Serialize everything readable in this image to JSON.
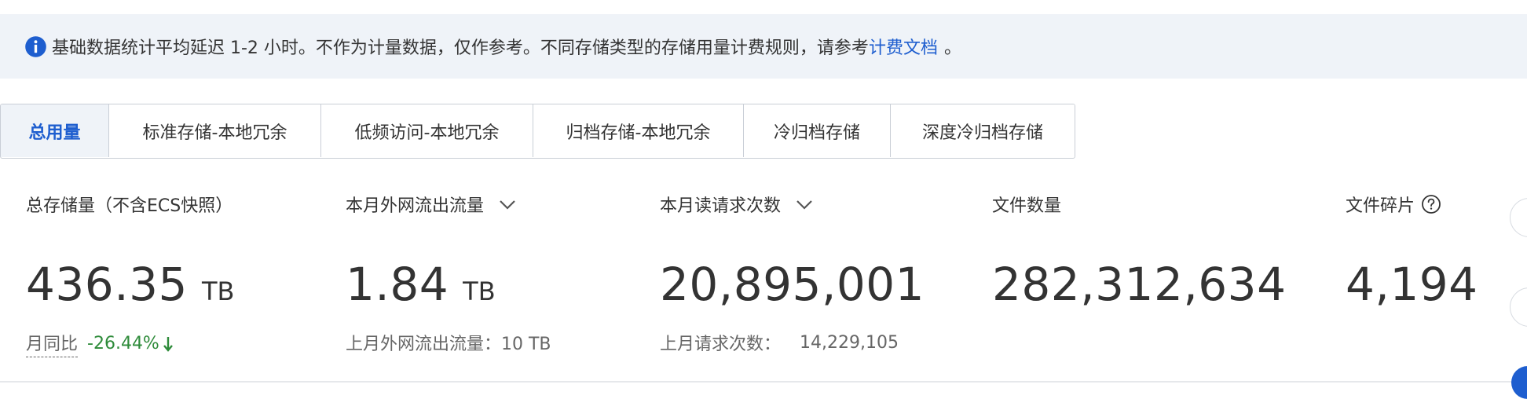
{
  "notice": {
    "text": "基础数据统计平均延迟 1-2 小时。不作为计量数据，仅作参考。不同存储类型的存储用量计费规则，请参考",
    "link": "计费文档",
    "tail": "。",
    "icon": "info-icon"
  },
  "tabs": [
    {
      "label": "总用量",
      "active": true
    },
    {
      "label": "标准存储-本地冗余"
    },
    {
      "label": "低频访问-本地冗余"
    },
    {
      "label": "归档存储-本地冗余"
    },
    {
      "label": "冷归档存储"
    },
    {
      "label": "深度冷归档存储"
    }
  ],
  "stats": {
    "total_storage": {
      "label": "总存储量（不含ECS快照）",
      "value": "436.35",
      "unit": "TB",
      "compare_label": "月同比",
      "compare_value": "-26.44%"
    },
    "outbound_traffic": {
      "label": "本月外网流出流量",
      "value": "1.84",
      "unit": "TB",
      "sub": "上月外网流出流量：10 TB"
    },
    "read_requests": {
      "label": "本月读请求次数",
      "value": "20,895,001",
      "sub_label": "上月请求次数：",
      "sub_value": "14,229,105"
    },
    "file_count": {
      "label": "文件数量",
      "value": "282,312,634"
    },
    "file_fragments": {
      "label": "文件碎片",
      "value": "4,194"
    }
  },
  "colors": {
    "accent": "#1e5ecf",
    "positive_change": "#2e8b3a",
    "notice_bg": "#eff3f8"
  }
}
